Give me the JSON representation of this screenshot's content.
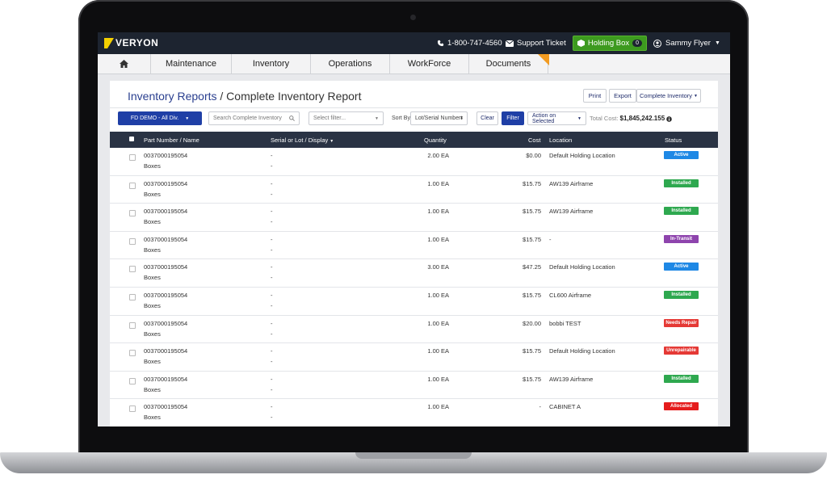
{
  "colors": {
    "active": "#1e88e5",
    "installed": "#2ea84f",
    "in_transit": "#8e44ad",
    "needs_repair": "#e53935",
    "unrepairable": "#e53935",
    "allocated": "#e51c1c"
  },
  "topbar": {
    "logo": "VERYON",
    "phone": "1-800-747-4560",
    "support": "Support Ticket",
    "holding_label": "Holding Box",
    "holding_count": "0",
    "user": "Sammy Flyer"
  },
  "nav": {
    "home_icon": "home-icon",
    "items": [
      "Maintenance",
      "Inventory",
      "Operations",
      "WorkForce",
      "Documents"
    ]
  },
  "page": {
    "crumb": "Inventory Reports",
    "title_sep": " / ",
    "title": "Complete Inventory Report",
    "print": "Print",
    "export": "Export",
    "report_select": "Complete Inventory"
  },
  "filters": {
    "division": "FD DEMO - All Div.",
    "search_placeholder": "Search Complete Inventory",
    "select_placeholder": "Select filter...",
    "sort_by_label": "Sort By",
    "sort_value": "Lot/Serial Number",
    "clear": "Clear",
    "filter": "Filter",
    "action": "Action on Selected",
    "total_label": "Total Cost:",
    "total_value": "$1,845,242.155"
  },
  "table": {
    "headers": {
      "part": "Part Number / Name",
      "serial": "Serial or Lot / Display",
      "quantity": "Quantity",
      "cost": "Cost",
      "location": "Location",
      "status": "Status"
    },
    "rows": [
      {
        "part": "0037000195054",
        "name": "Boxes",
        "serial": "-",
        "display": "-",
        "qty": "2.00 EA",
        "cost": "$0.00",
        "location": "Default Holding Location",
        "status": "Active",
        "status_key": "active"
      },
      {
        "part": "0037000195054",
        "name": "Boxes",
        "serial": "-",
        "display": "-",
        "qty": "1.00 EA",
        "cost": "$15.75",
        "location": "AW139 Airframe",
        "status": "Installed",
        "status_key": "installed"
      },
      {
        "part": "0037000195054",
        "name": "Boxes",
        "serial": "-",
        "display": "-",
        "qty": "1.00 EA",
        "cost": "$15.75",
        "location": "AW139 Airframe",
        "status": "Installed",
        "status_key": "installed"
      },
      {
        "part": "0037000195054",
        "name": "Boxes",
        "serial": "-",
        "display": "-",
        "qty": "1.00 EA",
        "cost": "$15.75",
        "location": "-",
        "status": "In-Transit",
        "status_key": "in_transit"
      },
      {
        "part": "0037000195054",
        "name": "Boxes",
        "serial": "-",
        "display": "-",
        "qty": "3.00 EA",
        "cost": "$47.25",
        "location": "Default Holding Location",
        "status": "Active",
        "status_key": "active"
      },
      {
        "part": "0037000195054",
        "name": "Boxes",
        "serial": "-",
        "display": "-",
        "qty": "1.00 EA",
        "cost": "$15.75",
        "location": "CL600 Airframe",
        "status": "Installed",
        "status_key": "installed"
      },
      {
        "part": "0037000195054",
        "name": "Boxes",
        "serial": "-",
        "display": "-",
        "qty": "1.00 EA",
        "cost": "$20.00",
        "location": "bobbi TEST",
        "status": "Needs Repair",
        "status_key": "needs_repair"
      },
      {
        "part": "0037000195054",
        "name": "Boxes",
        "serial": "-",
        "display": "-",
        "qty": "1.00 EA",
        "cost": "$15.75",
        "location": "Default Holding Location",
        "status": "Unrepairable",
        "status_key": "unrepairable"
      },
      {
        "part": "0037000195054",
        "name": "Boxes",
        "serial": "-",
        "display": "-",
        "qty": "1.00 EA",
        "cost": "$15.75",
        "location": "AW139 Airframe",
        "status": "Installed",
        "status_key": "installed"
      },
      {
        "part": "0037000195054",
        "name": "Boxes",
        "serial": "-",
        "display": "-",
        "qty": "1.00 EA",
        "cost": "-",
        "location": "CABINET A",
        "status": "Allocated",
        "status_key": "allocated"
      }
    ]
  }
}
